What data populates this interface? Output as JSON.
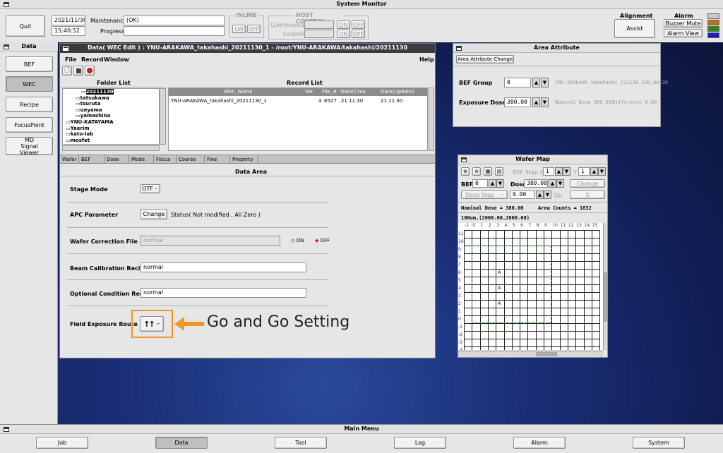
{
  "system_monitor": {
    "title": "System Monitor",
    "quit_label": "Quit",
    "date": "2021/11/30",
    "time": "15:40:52",
    "maintenance_label": "Maintenance:",
    "maintenance_value": "(OK)",
    "progress_label": "Progress:",
    "inline": {
      "title": "INLINE",
      "on": "ON",
      "off": "OFF"
    },
    "host_control": {
      "title": "HOST CONTROL",
      "communicate_label": "Communicate",
      "control_label": "Control",
      "on": "ON",
      "off": "OFF"
    },
    "alignment": {
      "title": "Alignment",
      "assist_label": "Assist"
    },
    "alarm": {
      "title": "Alarm",
      "buzzer_mute": "Buzzer Mute",
      "alarm_view": "Alarm View",
      "indicator_colors": [
        "#c8c8c8",
        "#b9731c",
        "#2e8a1c",
        "#1c1cc0"
      ]
    }
  },
  "data_sidebar": {
    "title": "Data",
    "items": [
      "BEF",
      "WEC",
      "Recipe",
      "FocusPoint",
      "MD Signal Viewer"
    ],
    "active": "WEC"
  },
  "wec_window": {
    "title": "Data( WEC Edit ) : YNU-ARAKAWA_takahashi_20211130_1 - /root/YNU-ARAKAWA/takahashi/20211130",
    "menu": [
      "File",
      "Record",
      "Window"
    ],
    "menu_help": "Help",
    "folder_list_title": "Folder List",
    "folders": [
      "20211130",
      "tatsukawa",
      "tsuruta",
      "ueyama",
      "yamashina",
      "YNU-KATAYAMA",
      "Yaerim",
      "kato-lab",
      "mosfet"
    ],
    "record_list_title": "Record List",
    "record_columns": [
      "WEC_Name",
      "Ver.",
      "File_#",
      "Date(Crea",
      "Date(Update)"
    ],
    "records": [
      {
        "name": "YNU-ARAKAWA_takahashi_20211130_1",
        "ver": "4",
        "file": "6527",
        "created": "21.11.30",
        "updated": "21.11.30"
      }
    ],
    "tabs": [
      "Wafer",
      "BEF",
      "Dose",
      "Mode",
      "Focus",
      "Coarse",
      "Fine",
      "Property"
    ],
    "data_area_title": "Data Area",
    "stage_mode_label": "Stage Mode",
    "stage_mode_value": "OTF",
    "apc_label": "APC Parameter",
    "apc_change": "Change",
    "apc_status": "Status( Not modified , All Zero )",
    "wafer_correction_label": "Wafer Correction File",
    "wafer_correction_value": "normal",
    "on_label": "ON",
    "off_label": "OFF",
    "beam_calibration_label": "Beam Calibration Recipe",
    "beam_calibration_value": "normal",
    "optional_condition_label": "Optional Condition Recipe",
    "optional_condition_value": "normal",
    "field_exposure_label": "Field Exposure Route",
    "annotation": "Go and Go Setting"
  },
  "area_attribute": {
    "title": "Area Attribute",
    "change_button": "Area Attribute Change",
    "bef_group_label": "BEF Group",
    "bef_group_value": "0",
    "bef_file": "YNU-ARAKAWA_takahashi_211130_220.bef20",
    "exposure_dose_label": "Exposure Dose",
    "exposure_dose_value": "380.00",
    "nominal_dose": "Nominal Dose 380.00",
    "difference": "Difference 0.00"
  },
  "wafer_map": {
    "title": "Wafer Map",
    "bef_step_label": "BEF Step X",
    "bef_step_x": "1",
    "y_label": "Y",
    "bef_step_y": "1",
    "bef_label": "BEF",
    "bef_value": "0",
    "dose_label": "Dose",
    "dose_value": "380.00",
    "change_label": "Change",
    "dose_step_label": "Dose Step",
    "dose_step_value": "0.00",
    "dir_label": "Dir.",
    "dir_value": "X",
    "nominal_dose": "Nominal Dose = 380.00",
    "area_counts": "Area Counts = 1832",
    "field_info": "100um,(2000.00,2000.00)",
    "col_labels": [
      "-1",
      "0",
      "1",
      "2",
      "3",
      "4",
      "5",
      "6",
      "7",
      "8",
      "9",
      "10",
      "11",
      "12",
      "13",
      "14",
      "15"
    ],
    "row_labels": [
      "11",
      "10",
      "9",
      "8",
      "7",
      "6",
      "5",
      "4",
      "3",
      "2",
      "1",
      "0",
      "-1",
      "-2",
      "-3",
      "-4"
    ],
    "marks": [
      {
        "col": 3,
        "row": 6
      },
      {
        "col": 3,
        "row": 4
      },
      {
        "col": 3,
        "row": 2
      }
    ],
    "mark_text": "A"
  },
  "main_menu": {
    "title": "Main Menu",
    "items": [
      "Job",
      "Data",
      "Tool",
      "Log",
      "Alarm",
      "System"
    ],
    "active": "Data"
  }
}
